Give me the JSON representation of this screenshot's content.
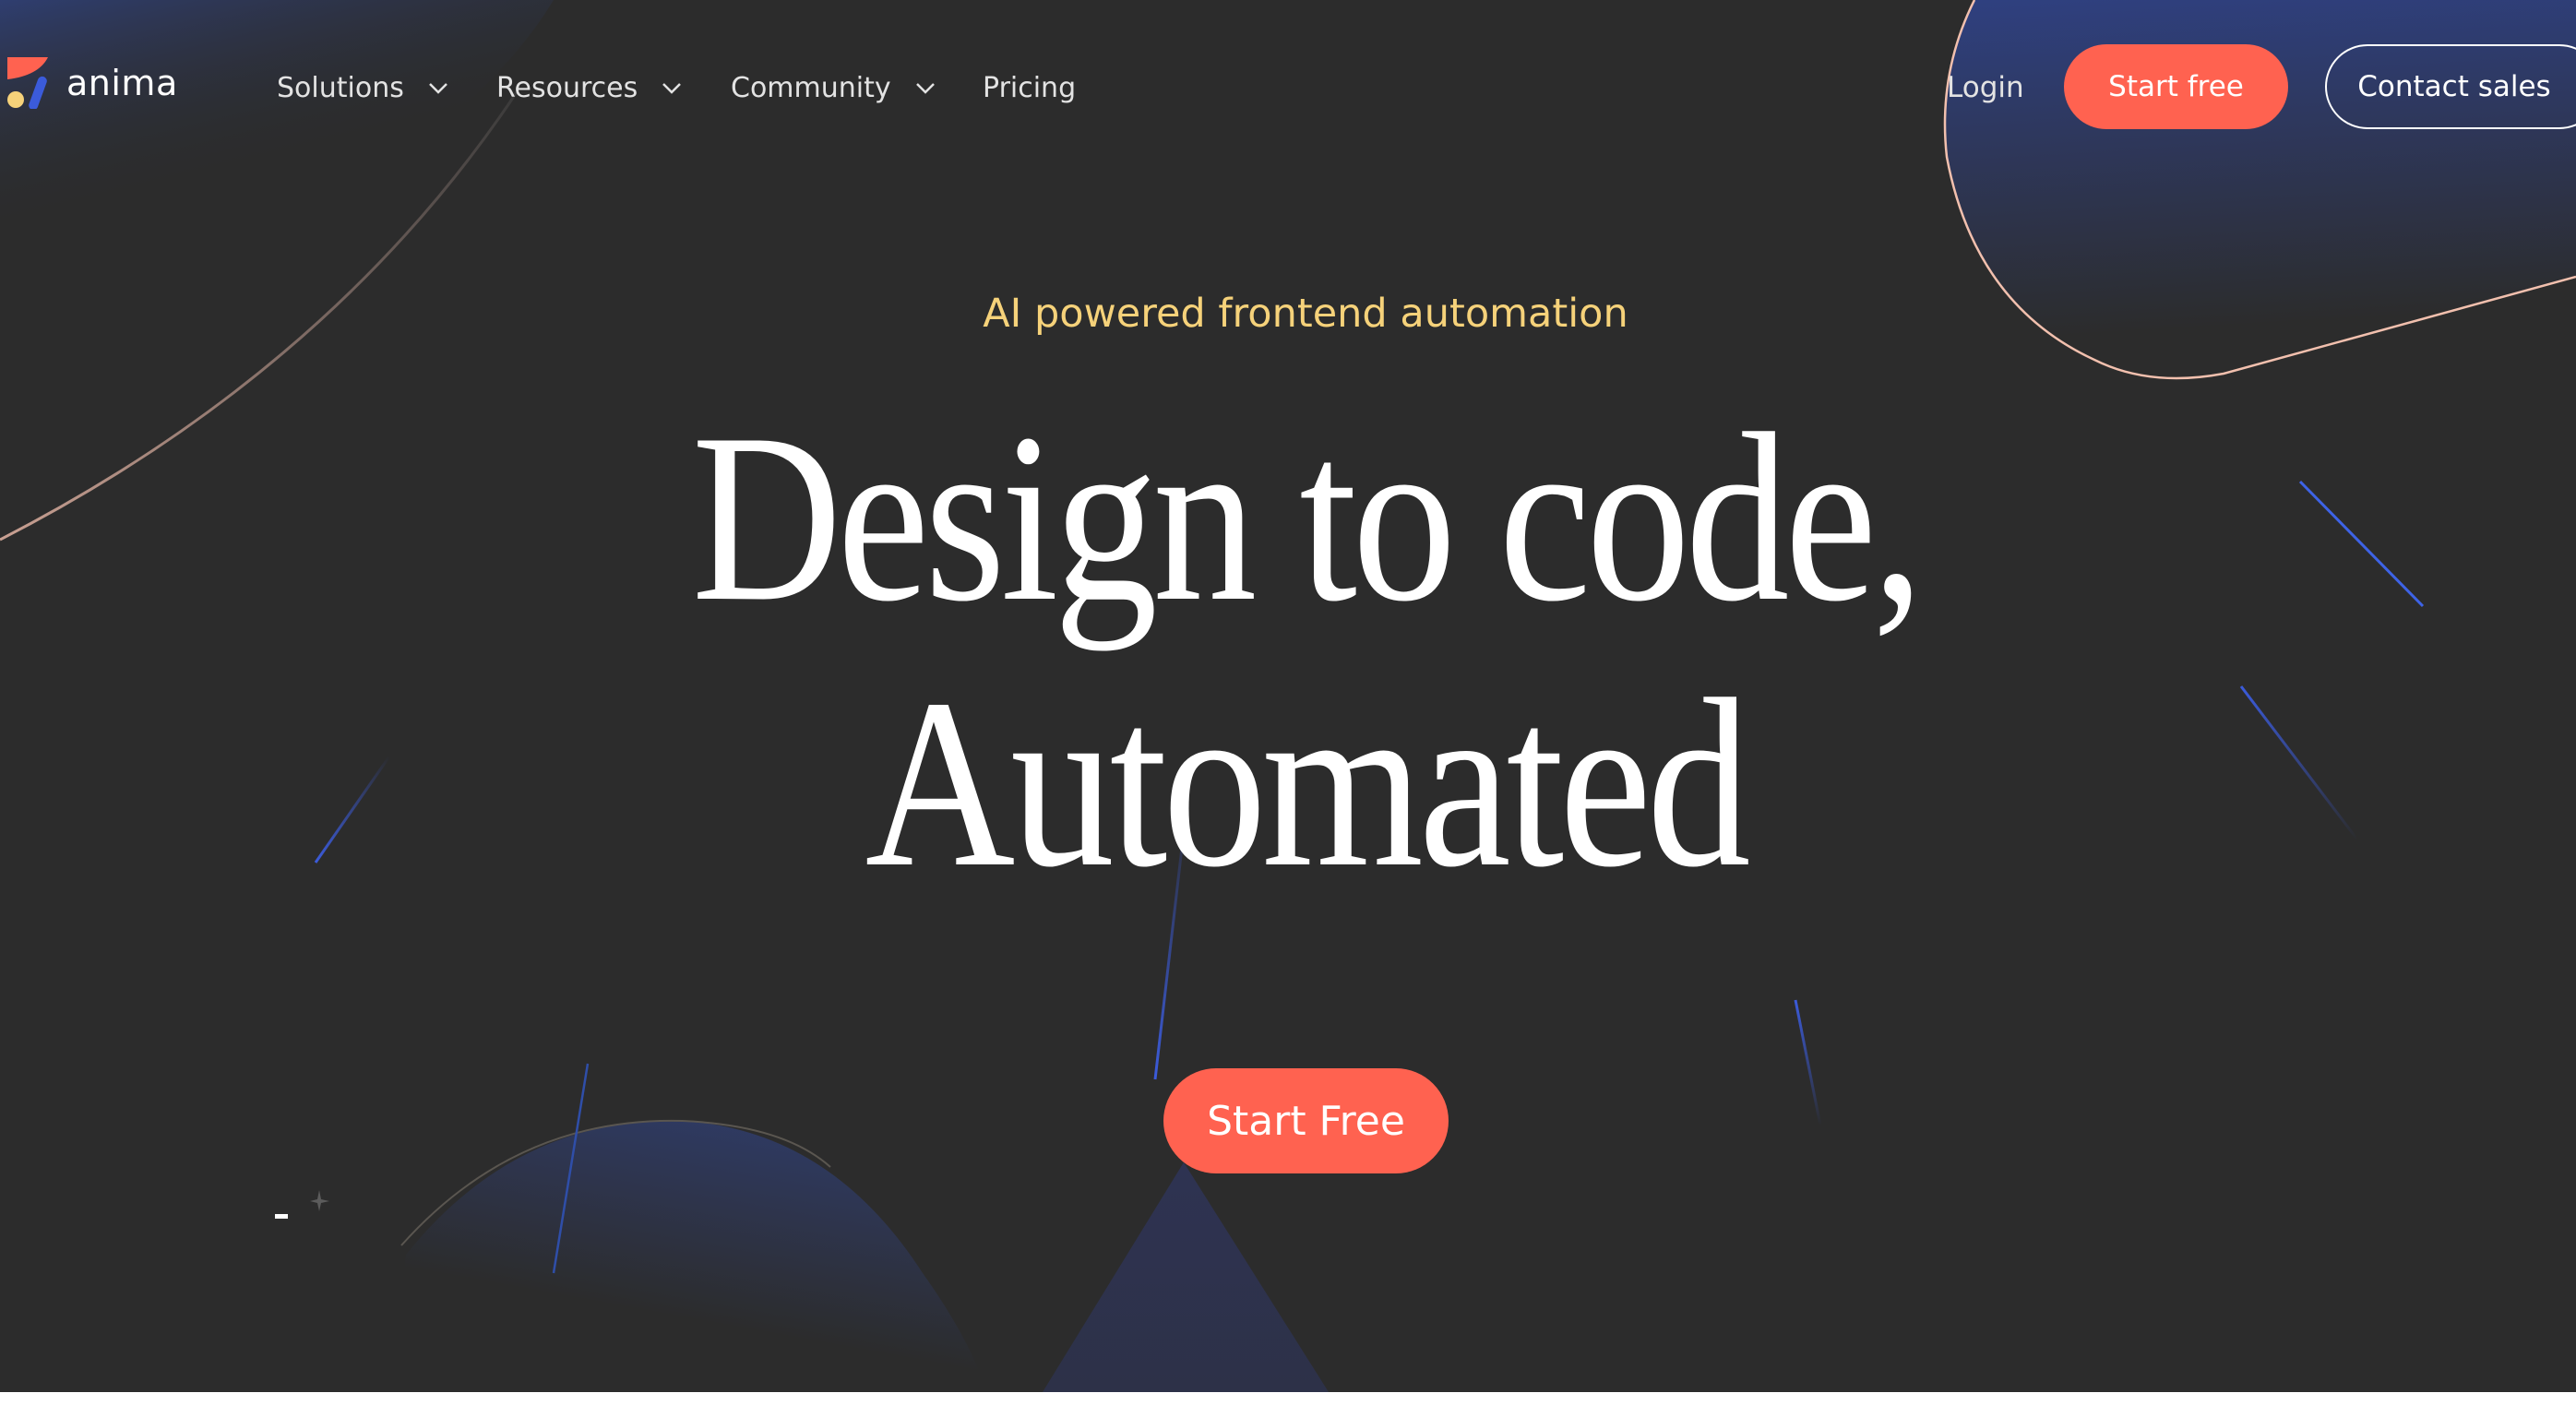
{
  "brand": {
    "name": "anima",
    "colors": {
      "accent": "#ff6250",
      "yellow": "#f6d27a",
      "blue": "#3b5bdb",
      "background": "#2c2c2c"
    }
  },
  "nav": {
    "items": [
      {
        "label": "Solutions",
        "has_dropdown": true
      },
      {
        "label": "Resources",
        "has_dropdown": true
      },
      {
        "label": "Community",
        "has_dropdown": true
      },
      {
        "label": "Pricing",
        "has_dropdown": false
      }
    ],
    "login_label": "Login",
    "start_free_label": "Start free",
    "contact_sales_label": "Contact sales"
  },
  "hero": {
    "eyebrow": "AI powered frontend automation",
    "headline_line1": "Design to code,",
    "headline_line2": "Automated",
    "cta_label": "Start Free"
  },
  "icons": {
    "logo": "anima-logo-icon",
    "dropdown": "chevron-down-icon"
  }
}
